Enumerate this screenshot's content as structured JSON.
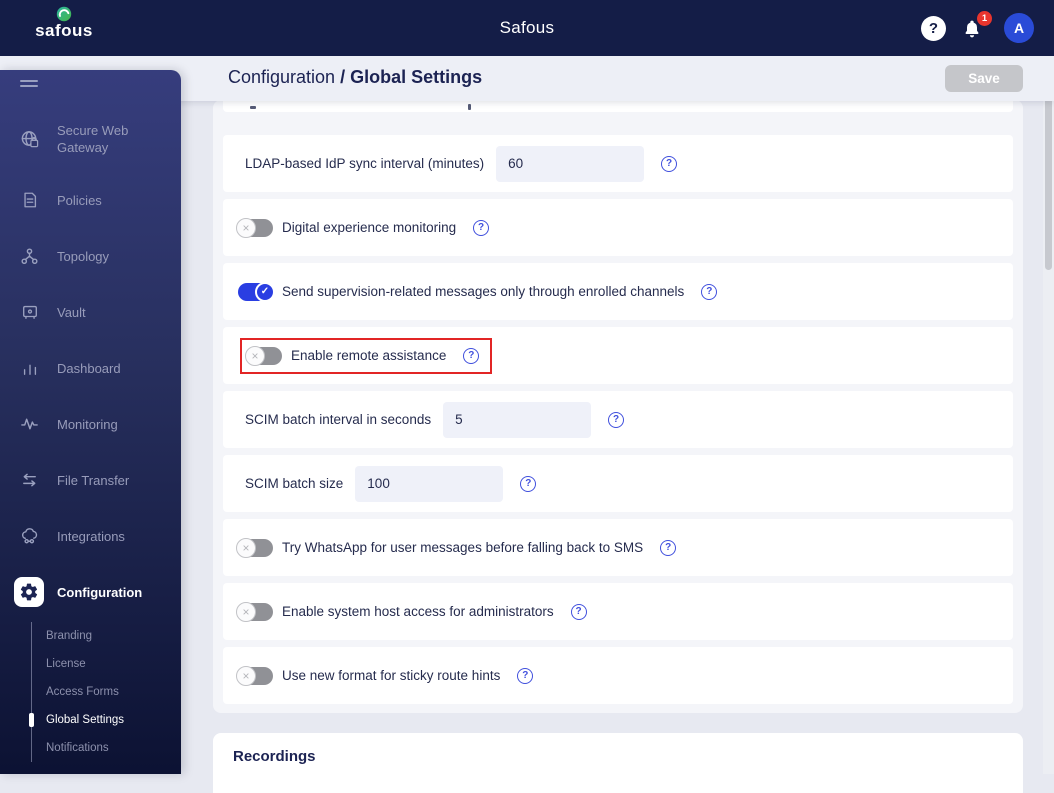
{
  "topbar": {
    "brand": "safous",
    "title": "Safous",
    "notification_count": "1",
    "avatar_initial": "A"
  },
  "header": {
    "breadcrumb_parent": "Configuration ",
    "breadcrumb_separator": "/ ",
    "breadcrumb_current": "Global Settings",
    "save_label": "Save"
  },
  "sidebar": {
    "items": [
      {
        "label": "Secure Web Gateway",
        "icon": "globe-lock-icon"
      },
      {
        "label": "Policies",
        "icon": "document-icon"
      },
      {
        "label": "Topology",
        "icon": "topology-icon"
      },
      {
        "label": "Vault",
        "icon": "vault-icon"
      },
      {
        "label": "Dashboard",
        "icon": "bar-chart-icon"
      },
      {
        "label": "Monitoring",
        "icon": "activity-icon"
      },
      {
        "label": "File Transfer",
        "icon": "transfer-arrows-icon"
      },
      {
        "label": "Integrations",
        "icon": "cloud-integration-icon"
      },
      {
        "label": "Configuration",
        "icon": "gear-icon",
        "active": true
      }
    ],
    "subitems": [
      {
        "label": "Branding"
      },
      {
        "label": "License"
      },
      {
        "label": "Access Forms"
      },
      {
        "label": "Global Settings",
        "active": true
      },
      {
        "label": "Notifications"
      }
    ]
  },
  "settings": {
    "rows": [
      {
        "label": "LDAP-based IdP sync interval (minutes)",
        "type": "input",
        "value": "60"
      },
      {
        "label": "Digital experience monitoring",
        "type": "toggle",
        "state": "off"
      },
      {
        "label": "Send supervision-related messages only through enrolled channels",
        "type": "toggle",
        "state": "on"
      },
      {
        "label": "Enable remote assistance",
        "type": "toggle",
        "state": "off",
        "highlighted": true
      },
      {
        "label": "SCIM batch interval in seconds",
        "type": "input",
        "value": "5"
      },
      {
        "label": "SCIM batch size",
        "type": "input",
        "value": "100"
      },
      {
        "label": "Try WhatsApp for user messages before falling back to SMS",
        "type": "toggle",
        "state": "off"
      },
      {
        "label": "Enable system host access for administrators",
        "type": "toggle",
        "state": "off"
      },
      {
        "label": "Use new format for sticky route hints",
        "type": "toggle",
        "state": "off"
      }
    ]
  },
  "recordings": {
    "title": "Recordings"
  },
  "colors": {
    "topbar_bg": "#141d47",
    "sidebar_top": "#363d7d",
    "sidebar_bottom": "#0c1233",
    "accent_blue": "#2a3ee2",
    "help_icon": "#4150dd",
    "highlight_red": "#e22525",
    "badge_red": "#e8352e",
    "avatar_blue": "#2a4bd7",
    "brand_green": "#3fae6a",
    "page_bg": "#e7e9f1"
  }
}
